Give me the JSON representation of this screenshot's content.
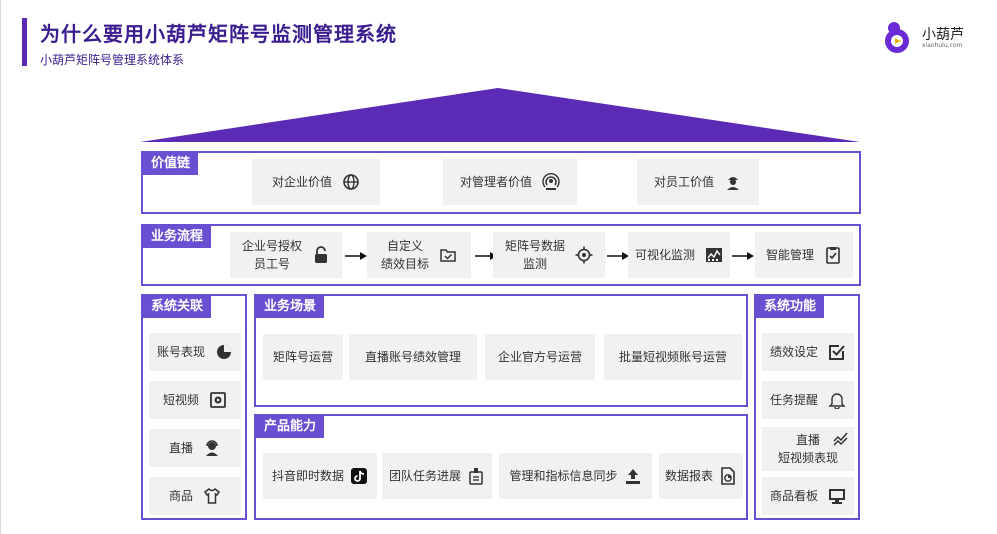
{
  "header": {
    "title": "为什么要用小葫芦矩阵号监测管理系统",
    "subtitle": "小葫芦矩阵号管理系统体系"
  },
  "logo": {
    "name": "小葫芦",
    "domain": "xiaohulu.com"
  },
  "colors": {
    "accent": "#6a4fd3",
    "title": "#3b1d8f",
    "card_bg": "#f1f1f1"
  },
  "value_chain": {
    "label": "价值链",
    "items": [
      {
        "label": "对企业价值",
        "icon": "globe-icon"
      },
      {
        "label": "对管理者价值",
        "icon": "broadcast-icon"
      },
      {
        "label": "对员工价值",
        "icon": "worker-icon"
      }
    ]
  },
  "workflow": {
    "label": "业务流程",
    "steps": [
      {
        "line1": "企业号授权",
        "line2": "员工号",
        "icon": "lock-icon"
      },
      {
        "line1": "自定义",
        "line2": "绩效目标",
        "icon": "folder-check-icon"
      },
      {
        "line1": "矩阵号数据",
        "line2": "监测",
        "icon": "target-icon"
      },
      {
        "line1": "可视化监测",
        "line2": "",
        "icon": "chart-icon"
      },
      {
        "line1": "智能管理",
        "line2": "",
        "icon": "clipboard-check-icon"
      }
    ]
  },
  "system_links": {
    "label": "系统关联",
    "items": [
      {
        "label": "账号表现",
        "icon": "pie-icon"
      },
      {
        "label": "短视频",
        "icon": "video-icon"
      },
      {
        "label": "直播",
        "icon": "streamer-icon"
      },
      {
        "label": "商品",
        "icon": "shirt-icon"
      }
    ]
  },
  "scenarios": {
    "label": "业务场景",
    "items": [
      "矩阵号运营",
      "直播账号绩效管理",
      "企业官方号运营",
      "批量短视频账号运营"
    ]
  },
  "capabilities": {
    "label": "产品能力",
    "items": [
      {
        "label": "抖音即时数据",
        "icon": "tiktok-icon"
      },
      {
        "label": "团队任务进展",
        "icon": "badge-icon"
      },
      {
        "label": "管理和指标信息同步",
        "icon": "upload-icon"
      },
      {
        "label": "数据报表",
        "icon": "report-icon"
      }
    ]
  },
  "functions": {
    "label": "系统功能",
    "items": [
      {
        "line1": "绩效设定",
        "line2": "",
        "icon": "checkbox-icon"
      },
      {
        "line1": "任务提醒",
        "line2": "",
        "icon": "bell-icon"
      },
      {
        "line1": "直播",
        "line2": "短视频表现",
        "icon": "trend-icon"
      },
      {
        "line1": "商品看板",
        "line2": "",
        "icon": "monitor-icon"
      }
    ]
  }
}
